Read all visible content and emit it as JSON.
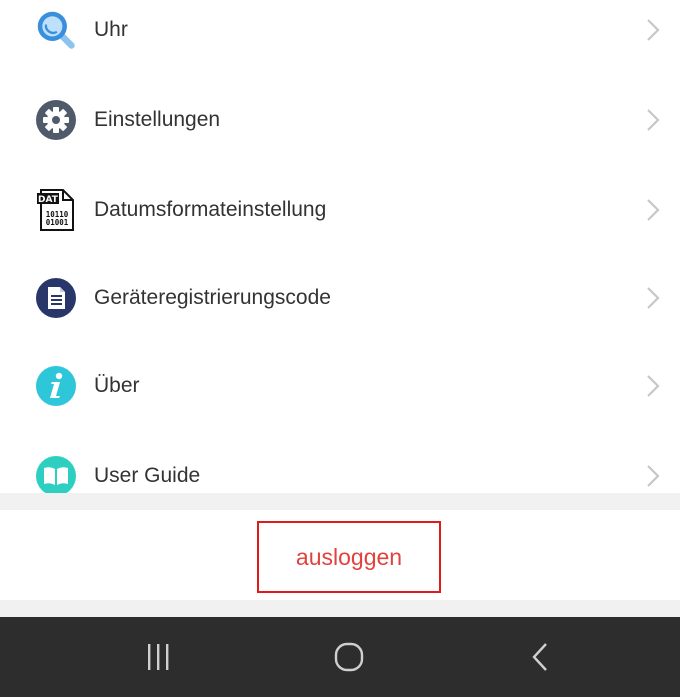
{
  "menu": {
    "items": [
      {
        "label": "Uhr",
        "icon": "clock-magnifier-icon"
      },
      {
        "label": "Einstellungen",
        "icon": "gear-icon"
      },
      {
        "label": "Datumsformateinstellung",
        "icon": "dat-file-icon",
        "icon_text_top": "DAT",
        "icon_text_line1": "10110",
        "icon_text_line2": "01001"
      },
      {
        "label": "Geräteregistrierungscode",
        "icon": "document-icon"
      },
      {
        "label": "Über",
        "icon": "info-icon"
      },
      {
        "label": "User Guide",
        "icon": "book-icon"
      }
    ]
  },
  "logout": {
    "label": "ausloggen"
  },
  "navbar": {
    "recent": "recent-apps-icon",
    "home": "home-icon",
    "back": "back-icon"
  },
  "colors": {
    "text": "#333333",
    "chevron": "#c7c7c7",
    "logout_text": "#e2423d",
    "logout_border": "#e01b1b",
    "navbar_bg": "#2d2d2d",
    "divider": "#f1f1f1"
  }
}
